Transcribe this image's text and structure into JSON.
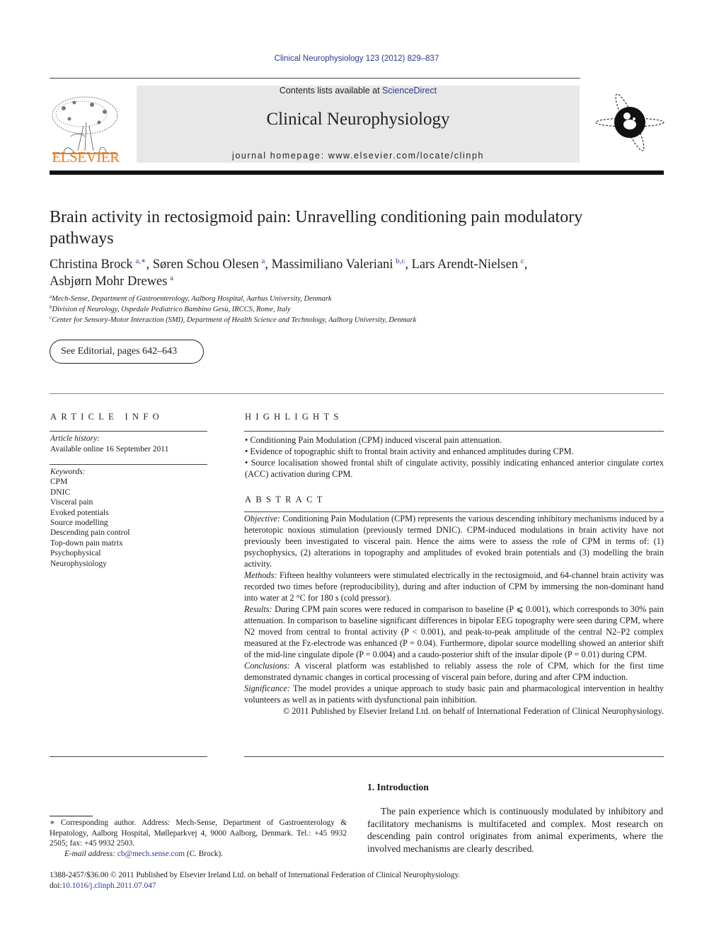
{
  "header": {
    "journal_reference": "Clinical Neurophysiology 123 (2012) 829–837",
    "contents_prefix": "Contents lists available at ",
    "contents_link": "ScienceDirect",
    "journal_name": "Clinical Neurophysiology",
    "homepage": "journal homepage: www.elsevier.com/locate/clinph",
    "publisher_logo_text": "ELSEVIER",
    "publisher_color": "#f07c1a",
    "link_color": "#2b3a8c"
  },
  "article": {
    "title": "Brain activity in rectosigmoid pain: Unravelling conditioning pain modulatory pathways",
    "authors": [
      {
        "name": "Christina Brock",
        "sup": "a,∗",
        "sep": ", "
      },
      {
        "name": "Søren Schou Olesen",
        "sup": "a",
        "sep": ", "
      },
      {
        "name": "Massimiliano Valeriani",
        "sup": "b,c",
        "sep": ", "
      },
      {
        "name": "Lars Arendt-Nielsen",
        "sup": "c",
        "sep": ","
      },
      {
        "name": "Asbjørn Mohr Drewes",
        "sup": "a",
        "sep": ""
      }
    ],
    "affiliations": [
      {
        "sup": "a",
        "text": "Mech-Sense, Department of Gastroenterology, Aalborg Hospital, Aarhus University, Denmark"
      },
      {
        "sup": "b",
        "text": "Division of Neurology, Ospedale Pediatrico Bambino Gesù, IRCCS, Rome, Italy"
      },
      {
        "sup": "c",
        "text": "Center for Sensory-Motor Interaction (SMI), Department of Health Science and Technology, Aalborg University, Denmark"
      }
    ],
    "editorial_link": "See Editorial, pages 642–643"
  },
  "article_info": {
    "heading": "ARTICLE INFO",
    "history_label": "Article history:",
    "history_value": "Available online 16 September 2011",
    "keywords_label": "Keywords:",
    "keywords": [
      "CPM",
      "DNIC",
      "Visceral pain",
      "Evoked potentials",
      "Source modelling",
      "Descending pain control",
      "Top-down pain matrix",
      "Psychophysical",
      "Neurophysiology"
    ]
  },
  "highlights": {
    "heading": "HIGHLIGHTS",
    "items": [
      "Conditioning Pain Modulation (CPM) induced visceral pain attenuation.",
      "Evidence of topographic shift to frontal brain activity and enhanced amplitudes during CPM.",
      "Source localisation showed frontal shift of cingulate activity, possibly indicating enhanced anterior cingulate cortex (ACC) activation during CPM."
    ]
  },
  "abstract": {
    "heading": "ABSTRACT",
    "sections": [
      {
        "label": "Objective:",
        "text": " Conditioning Pain Modulation (CPM) represents the various descending inhibitory mechanisms induced by a heterotopic noxious stimulation (previously termed DNIC). CPM-induced modulations in brain activity have not previously been investigated to visceral pain. Hence the aims were to assess the role of CPM in terms of: (1) psychophysics, (2) alterations in topography and amplitudes of evoked brain potentials and (3) modelling the brain activity."
      },
      {
        "label": "Methods:",
        "text": " Fifteen healthy volunteers were stimulated electrically in the rectosigmoid, and 64-channel brain activity was recorded two times before (reproducibility), during and after induction of CPM by immersing the non-dominant hand into water at 2 °C for 180 s (cold pressor)."
      },
      {
        "label": "Results:",
        "text": " During CPM pain scores were reduced in comparison to baseline (P ⩽ 0.001), which corresponds to 30% pain attenuation. In comparison to baseline significant differences in bipolar EEG topography were seen during CPM, where N2 moved from central to frontal activity (P < 0.001), and peak-to-peak amplitude of the central N2–P2 complex measured at the Fz-electrode was enhanced (P = 0.04). Furthermore, dipolar source modelling showed an anterior shift of the mid-line cingulate dipole (P = 0.004) and a caudo-posterior shift of the insular dipole (P = 0.01) during CPM."
      },
      {
        "label": "Conclusions:",
        "text": " A visceral platform was established to reliably assess the role of CPM, which for the first time demonstrated dynamic changes in cortical processing of visceral pain before, during and after CPM induction."
      },
      {
        "label": "Significance:",
        "text": " The model provides a unique approach to study basic pain and pharmacological intervention in healthy volunteers as well as in patients with dysfunctional pain inhibition."
      }
    ],
    "copyright": "© 2011 Published by Elsevier Ireland Ltd. on behalf of International Federation of Clinical Neurophysiology."
  },
  "introduction": {
    "heading": "1. Introduction",
    "text": "The pain experience which is continuously modulated by inhibitory and facilitatory mechanisms is multifaceted and complex. Most research on descending pain control originates from animal experiments, where the involved mechanisms are clearly described."
  },
  "footnote": {
    "corresponding": "∗ Corresponding author. Address: Mech-Sense, Department of Gastroenterology & Hepatology, Aalborg Hospital, Mølleparkvej 4, 9000 Aalborg, Denmark. Tel.: +45 9932 2505; fax: +45 9932 2503.",
    "email_label": "E-mail address:",
    "email": "cb@mech.sense.com",
    "email_suffix": " (C. Brock).",
    "issn_line": "1388-2457/$36.00 © 2011 Published by Elsevier Ireland Ltd. on behalf of International Federation of Clinical Neurophysiology.",
    "doi_prefix": "doi:",
    "doi": "10.1016/j.clinph.2011.07.047"
  }
}
